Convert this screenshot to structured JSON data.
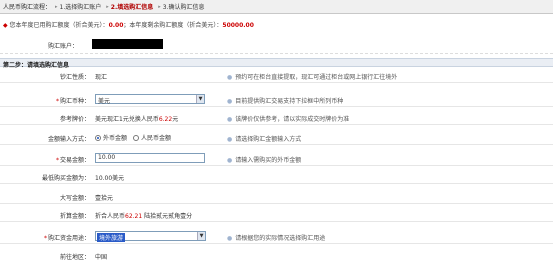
{
  "steps": {
    "title": "人民币购汇流程：",
    "items": [
      {
        "label": "1.选择购汇账户",
        "active": false
      },
      {
        "label": "2.填选购汇信息",
        "active": true
      },
      {
        "label": "3.确认购汇信息",
        "active": false
      }
    ]
  },
  "quota": {
    "icon": "◆",
    "prefix": "您本年度已用购汇额度（折合美元）：",
    "used": "0.00",
    "middle": "；本年度剩余购汇额度（折合美元）：",
    "remaining": "50000.00"
  },
  "account": {
    "label": "购汇账户："
  },
  "section": {
    "title": "第二步：请填选购汇信息"
  },
  "form": {
    "settlement": {
      "label": "钞汇性质：",
      "value": "现汇",
      "hint": "预约可在柜台直接提取，现汇可通过柜台或网上银行汇往境外"
    },
    "currency": {
      "label": "购汇币种：",
      "value": "美元",
      "hint": "目前提供购汇交易支持下拉框中所列币种"
    },
    "rate": {
      "label": "参考牌价：",
      "prefix": "美元现汇1元兑换人民币",
      "value": "6.22",
      "suffix": "元",
      "hint": "该牌价仅供参考，请以实际成交时牌价为准"
    },
    "amount_mode": {
      "label": "金额输入方式：",
      "options": [
        "外币金额",
        "人民币金额"
      ],
      "selected": 0,
      "hint": "请选择购汇金额输入方式"
    },
    "amount": {
      "label": "交易金额：",
      "value": "10.00",
      "hint": "请输入需购买的外币金额"
    },
    "min_amount": {
      "label": "最低购买金额为：",
      "value": "10.00美元"
    },
    "capital": {
      "label": "大写金额：",
      "value": "壹拾元"
    },
    "converted": {
      "label": "折算金额：",
      "prefix": "折合人民币",
      "value": "62.21",
      "suffix": " 陆拾贰元贰角壹分"
    },
    "purpose": {
      "label": "购汇资金用途：",
      "value": "境外旅游",
      "hint": "请根据您的实际情况选择购汇用途"
    },
    "destination": {
      "label": "前往地区：",
      "value": "中国"
    }
  }
}
